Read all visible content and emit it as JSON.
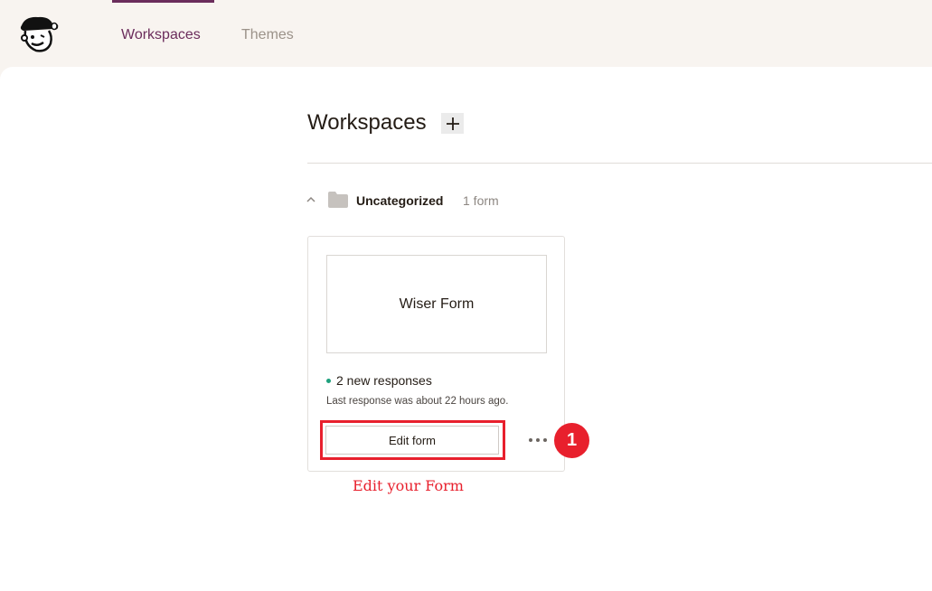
{
  "nav": {
    "tabs": [
      {
        "label": "Workspaces",
        "active": true
      },
      {
        "label": "Themes",
        "active": false
      }
    ]
  },
  "main": {
    "title": "Workspaces",
    "add_icon": "plus-icon"
  },
  "workspace": {
    "name": "Uncategorized",
    "count": "1 form",
    "expanded": true
  },
  "form_card": {
    "title": "Wiser Form",
    "new_responses": "2 new responses",
    "last_response": "Last response was about 22 hours ago.",
    "edit_label": "Edit form",
    "more_icon": "more-dots-icon"
  },
  "annotation": {
    "step": "1",
    "text": "Edit your Form"
  },
  "colors": {
    "brand": "#6b2d5c",
    "highlight": "#e8202d",
    "status_dot": "#1ea07d",
    "topbar_bg": "#f8f4f0"
  }
}
